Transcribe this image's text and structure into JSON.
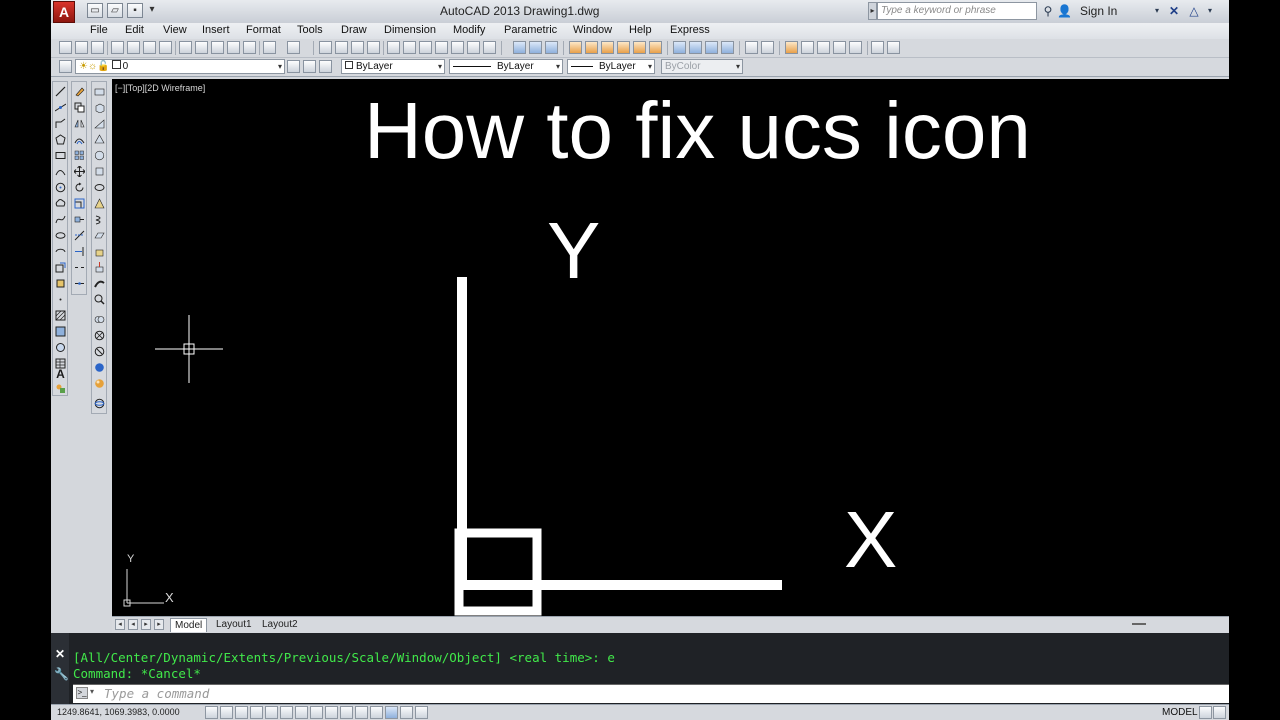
{
  "window": {
    "title": "AutoCAD 2013    Drawing1.dwg",
    "search_placeholder": "Type a keyword or phrase",
    "sign_in": "Sign In"
  },
  "menu": [
    "File",
    "Edit",
    "View",
    "Insert",
    "Format",
    "Tools",
    "Draw",
    "Dimension",
    "Modify",
    "Parametric",
    "Window",
    "Help",
    "Express"
  ],
  "properties": {
    "layer": "0",
    "color": "ByLayer",
    "linetype": "ByLayer",
    "lineweight": "ByLayer",
    "plotstyle": "ByColor"
  },
  "viewport": {
    "label": "[−][Top][2D Wireframe]",
    "overlay_title": "How to fix ucs icon",
    "big_ucs_y": "Y",
    "big_ucs_x": "X",
    "small_ucs_y": "Y",
    "small_ucs_x": "X"
  },
  "tabs": [
    "Model",
    "Layout1",
    "Layout2"
  ],
  "command": {
    "history_1": "[All/Center/Dynamic/Extents/Previous/Scale/Window/Object] <real time>: e",
    "history_2": "Command: *Cancel*",
    "placeholder": "Type a command"
  },
  "status": {
    "coordinates": "1249.8641, 1069.3983, 0.0000",
    "space": "MODEL"
  }
}
